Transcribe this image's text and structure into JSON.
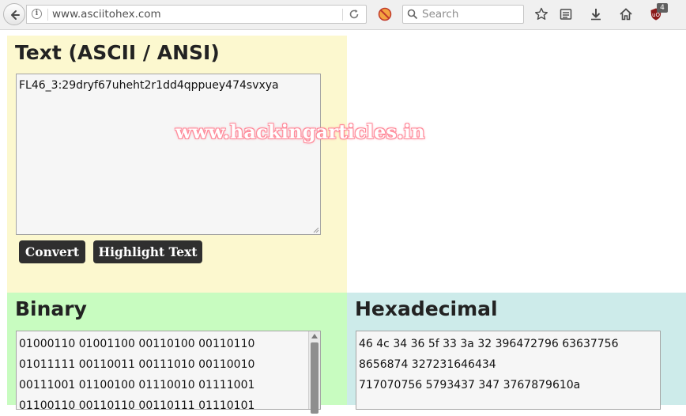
{
  "browser": {
    "url": "www.asciitohex.com",
    "search_placeholder": "Search",
    "ublock_count": "4"
  },
  "watermark": "www.hackingarticles.in",
  "text_panel": {
    "heading": "Text (ASCII / ANSI)",
    "value": "FL46_3:29dryf67uheht2r1dd4qppuey474svxya",
    "convert_label": "Convert",
    "highlight_label": "Highlight Text"
  },
  "binary_panel": {
    "heading": "Binary",
    "lines": [
      "01000110 01001100 00110100 00110110",
      "01011111 00110011 00111010 00110010",
      "00111001 01100100 01110010 01111001",
      "01100110 00110110 00110111 01110101"
    ]
  },
  "hex_panel": {
    "heading": "Hexadecimal",
    "lines": [
      "46 4c 34 36 5f 33 3a 32 396472796 63637756",
      "8656874 327231646434",
      "717070756 5793437 347 3767879610a"
    ]
  },
  "colors": {
    "text_panel_bg": "#fcf8cf",
    "binary_panel_bg": "#c8fcc0",
    "hex_panel_bg": "#cdebea",
    "button_bg": "#2f2f2f"
  }
}
